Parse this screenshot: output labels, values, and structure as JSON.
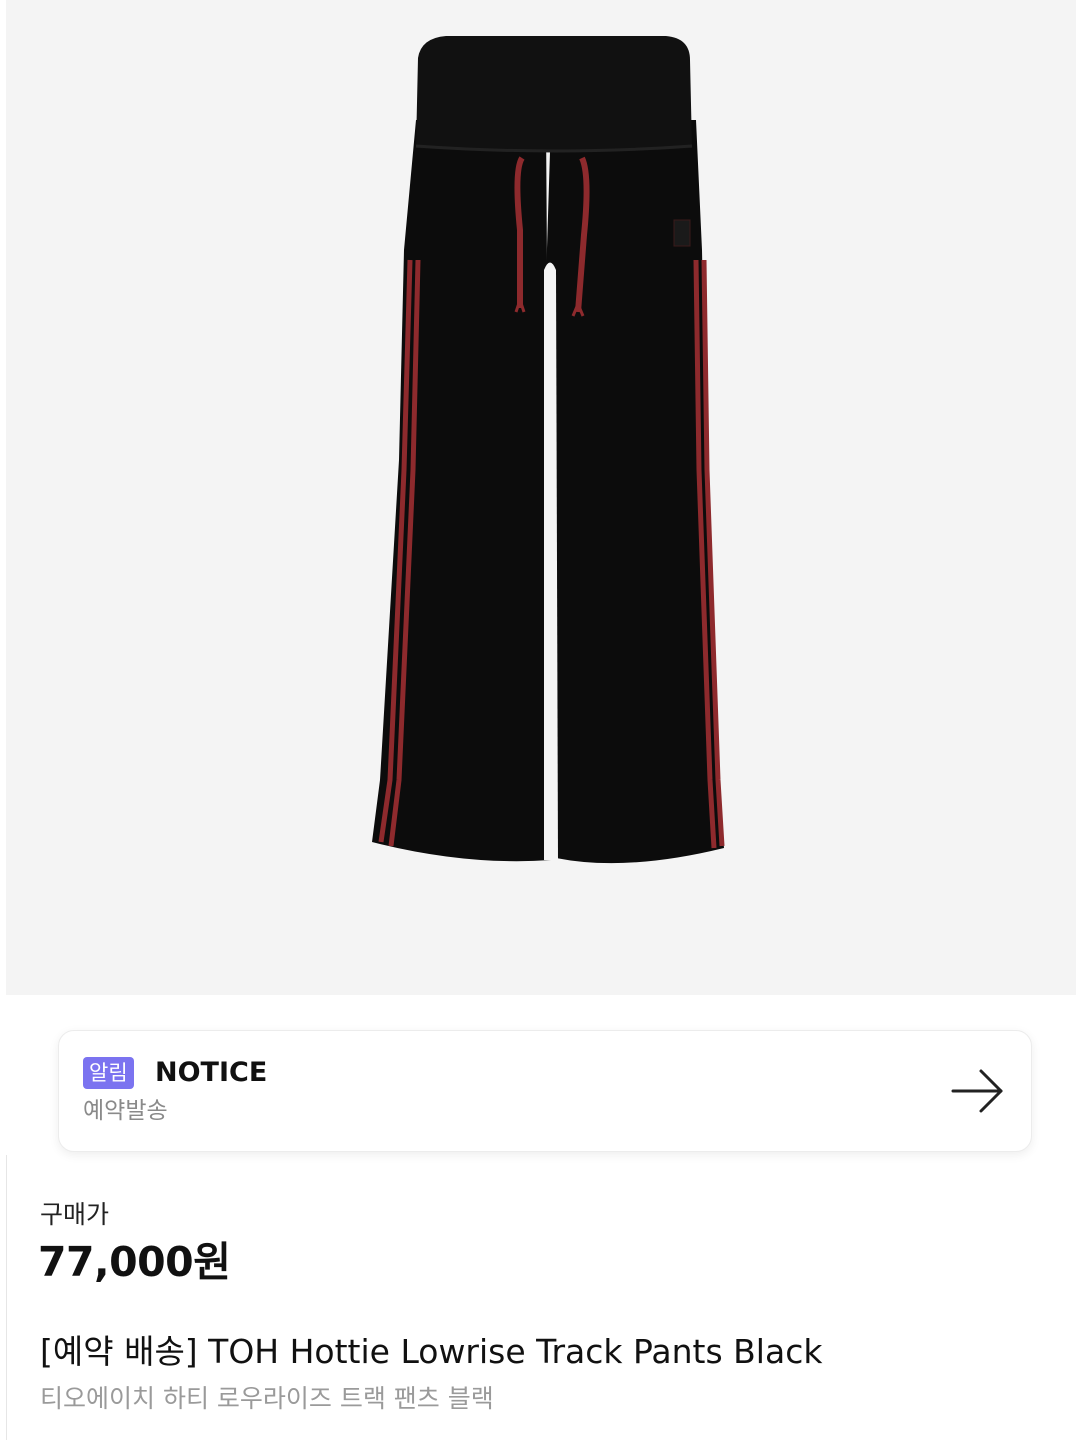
{
  "notice": {
    "badge": "알림",
    "title": "NOTICE",
    "subtitle": "예약발송",
    "arrow_icon": "arrow-right-icon"
  },
  "price": {
    "label": "구매가",
    "value": "77,000원"
  },
  "product": {
    "name": "[예약 배송] TOH Hottie Lowrise Track Pants Black",
    "name_ko": "티오에이치 하티 로우라이즈 트랙 팬츠 블랙",
    "image_icon": "track-pants-image"
  },
  "colors": {
    "image_bg": "#f4f4f4",
    "pants": "#0c0c0c",
    "stripe": "#8e2a2d",
    "badge_bg": "#7b73f0",
    "subtle_text": "#8a8a8a"
  }
}
